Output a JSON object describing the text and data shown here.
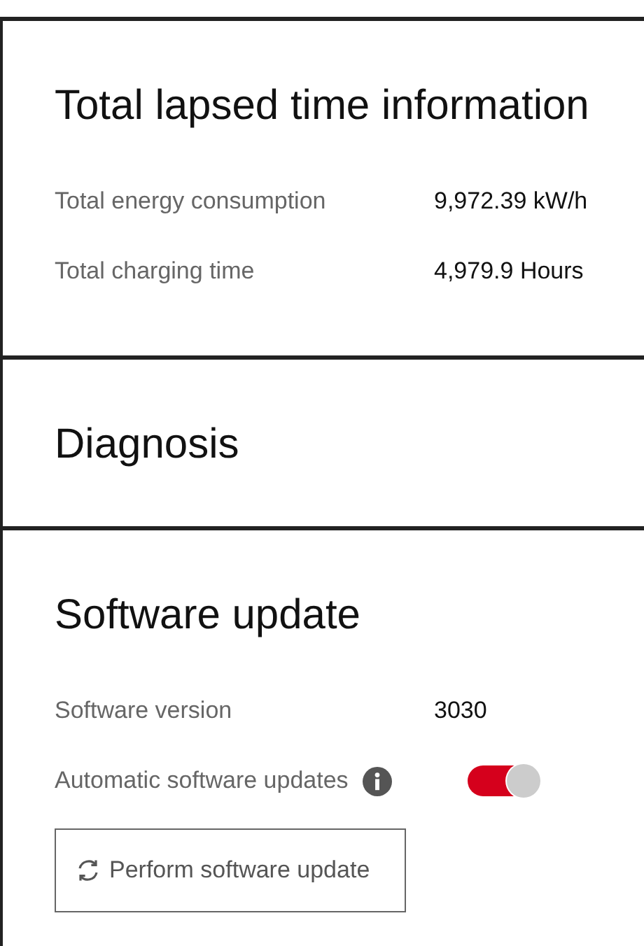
{
  "sections": [
    {
      "title": "Total lapsed time information",
      "rows": [
        {
          "kind": "text",
          "label": "Total energy consumption",
          "value": "9,972.39 kW/h"
        },
        {
          "kind": "text",
          "label": "Total charging time",
          "value": "4,979.9 Hours"
        }
      ]
    },
    {
      "title": "Diagnosis"
    },
    {
      "title": "Software update",
      "rows": [
        {
          "kind": "text",
          "label": "Software version",
          "value": "3030"
        },
        {
          "kind": "toggle",
          "label": "Automatic software updates",
          "on": true
        }
      ],
      "button": "Perform software update"
    }
  ]
}
